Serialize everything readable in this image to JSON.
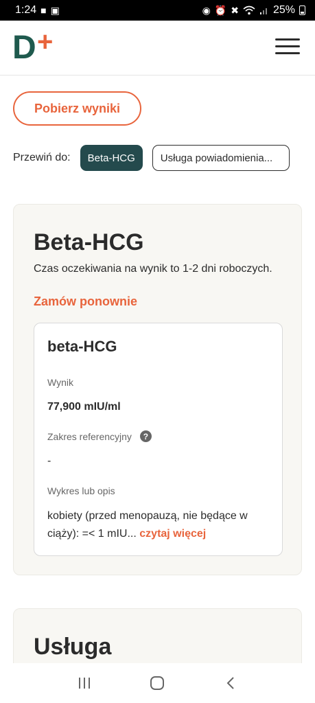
{
  "status_bar": {
    "time": "1:24",
    "battery": "25%"
  },
  "header": {
    "logo_letter": "D",
    "logo_mark": "+"
  },
  "actions": {
    "download_label": "Pobierz wyniki"
  },
  "scroll_to": {
    "label": "Przewiń do:",
    "chips": [
      "Beta-HCG",
      "Usługa powiadomienia..."
    ]
  },
  "card": {
    "title": "Beta-HCG",
    "subtitle": "Czas oczekiwania na wynik to 1-2 dni roboczych.",
    "reorder_label": "Zamów ponownie",
    "result": {
      "title": "beta-HCG",
      "result_label": "Wynik",
      "result_value": "77,900 mIU/ml",
      "reference_label": "Zakres referencyjny",
      "reference_value": "-",
      "description_label": "Wykres lub opis",
      "description_text": "kobiety (przed menopauzą, nie będące w ciąży): =< 1 mIU...",
      "read_more": "czytaj więcej"
    }
  },
  "card2": {
    "title": "Usługa"
  },
  "colors": {
    "accent": "#e8643c",
    "dark_teal": "#244a4d",
    "card_bg": "#f8f7f3"
  }
}
